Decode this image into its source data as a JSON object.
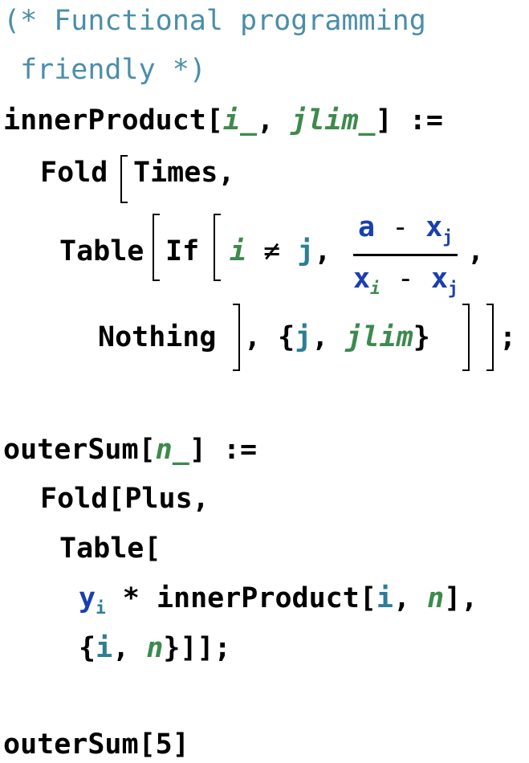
{
  "comment": {
    "line1": "(* Functional programming",
    "line2": " friendly *)"
  },
  "inner": {
    "name": "innerProduct",
    "open": "[",
    "arg1": "i_",
    "sep": ", ",
    "arg2": "jlim_",
    "close": "]",
    "assign": " :=",
    "fold": "Fold",
    "times": "Times,",
    "table": "Table",
    "if": "If",
    "cond_i": "i",
    "neq": " ≠ ",
    "cond_j": "j",
    "comma": ",",
    "frac_num_a": "a",
    "frac_num_minus": " - ",
    "frac_num_x": "x",
    "frac_num_sub": "j",
    "frac_den_x1": "x",
    "frac_den_sub1": "i",
    "frac_den_minus": " - ",
    "frac_den_x2": "x",
    "frac_den_sub2": "j",
    "trail_comma": ",",
    "nothing": "Nothing",
    "iter_open": ", {",
    "iter_j": "j",
    "iter_sep": ", ",
    "iter_jlim": "jlim",
    "iter_close": "}",
    "end": ";"
  },
  "outer": {
    "name": "outerSum",
    "open": "[",
    "arg": "n_",
    "close": "]",
    "assign": " :=",
    "fold": "Fold[Plus,",
    "table": "Table[",
    "y": "y",
    "y_sub": "i",
    "mult": " * ",
    "call": "innerProduct[",
    "call_i": "i",
    "call_sep": ", ",
    "call_n": "n",
    "call_close": "],",
    "iter_open": "{",
    "iter_i": "i",
    "iter_sep": ", ",
    "iter_n": "n",
    "iter_close": "}]];"
  },
  "invoke": {
    "text": "outerSum[5]"
  }
}
